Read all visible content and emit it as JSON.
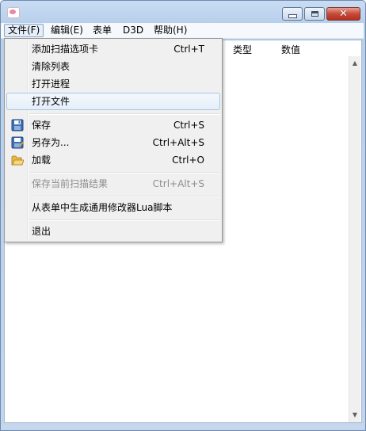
{
  "menubar": {
    "items": [
      {
        "label": "文件(F)"
      },
      {
        "label": "编辑(E)"
      },
      {
        "label": "表单"
      },
      {
        "label": "D3D"
      },
      {
        "label": "帮助(H)"
      }
    ]
  },
  "list": {
    "columns": [
      "类型",
      "数值"
    ]
  },
  "file_menu": {
    "items": [
      {
        "label": "添加扫描选项卡",
        "shortcut": "Ctrl+T"
      },
      {
        "label": "清除列表",
        "shortcut": ""
      },
      {
        "label": "打开进程",
        "shortcut": ""
      },
      {
        "label": "打开文件",
        "shortcut": ""
      },
      {
        "label": "保存",
        "shortcut": "Ctrl+S",
        "icon": "floppy-disk-icon"
      },
      {
        "label": "另存为...",
        "shortcut": "Ctrl+Alt+S",
        "icon": "floppy-disk-save-as-icon"
      },
      {
        "label": "加载",
        "shortcut": "Ctrl+O",
        "icon": "open-folder-icon"
      },
      {
        "label": "保存当前扫描结果",
        "shortcut": "Ctrl+Alt+S",
        "disabled": true
      },
      {
        "label": "从表单中生成通用修改器Lua脚本",
        "shortcut": ""
      },
      {
        "label": "退出",
        "shortcut": ""
      }
    ]
  },
  "colors": {
    "menu_highlight_border": "#a8c5ea",
    "close_button": "#c7493a",
    "disabled_text": "#8d8d8d"
  }
}
